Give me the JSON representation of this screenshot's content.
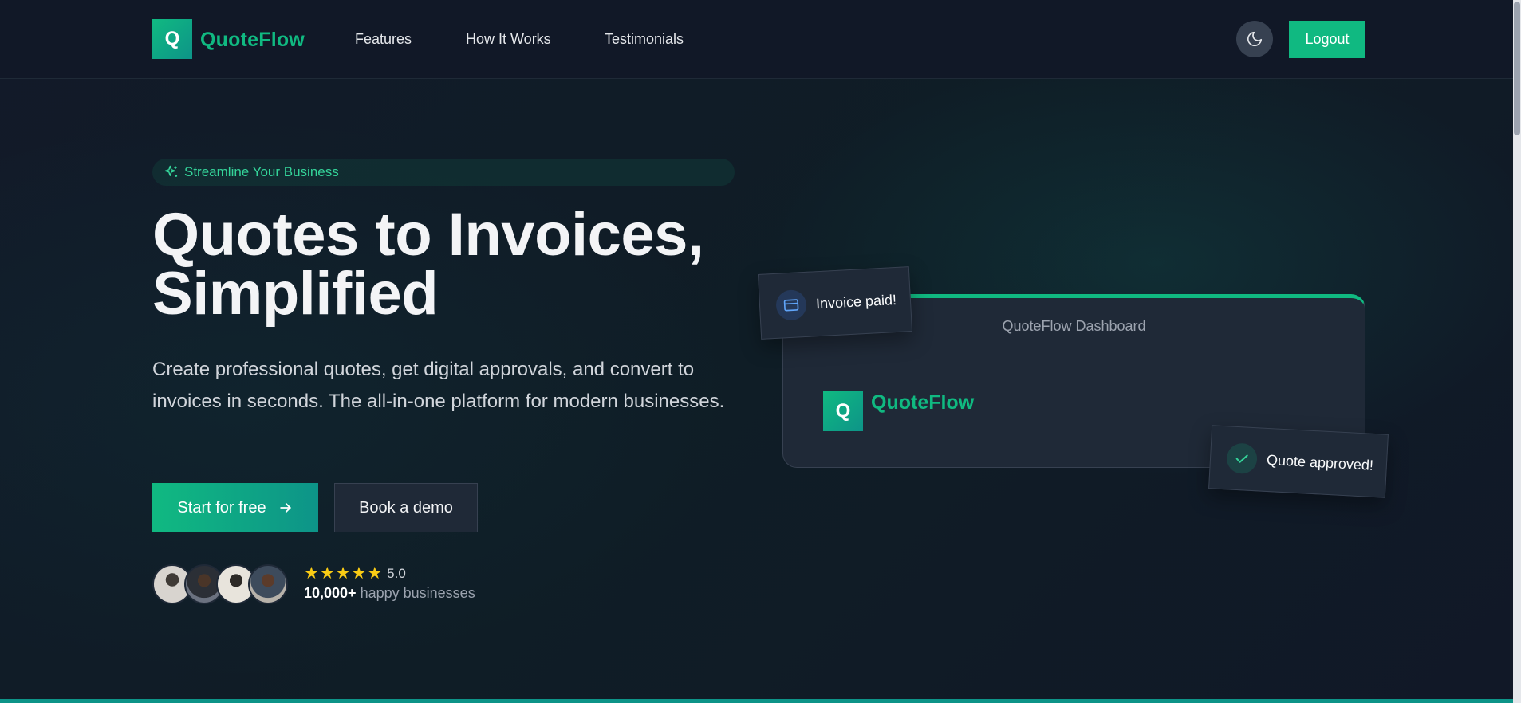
{
  "brand": {
    "logo_letter": "Q",
    "name": "QuoteFlow",
    "accent": "#10b981"
  },
  "nav": {
    "links": [
      "Features",
      "How It Works",
      "Testimonials"
    ],
    "theme_icon": "moon-icon",
    "logout_label": "Logout"
  },
  "hero": {
    "badge_icon": "sparkles-icon",
    "badge": "Streamline Your Business",
    "title_line1": "Quotes to Invoices,",
    "title_line2": "Simplified",
    "subtitle": "Create professional quotes, get digital approvals, and convert to invoices in seconds. The all-in-one platform for modern businesses.",
    "cta_primary": "Start for free",
    "cta_primary_icon": "arrow-right-icon",
    "cta_secondary": "Book a demo"
  },
  "social_proof": {
    "avatars_count": 4,
    "stars": 5,
    "rating": "5.0",
    "count": "10,000+",
    "label": "happy businesses"
  },
  "dashboard": {
    "header": "QuoteFlow Dashboard",
    "logo_letter": "Q",
    "logo_text": "QuoteFlow"
  },
  "toasts": {
    "invoice": {
      "icon": "credit-card-icon",
      "text": "Invoice paid!"
    },
    "quote": {
      "icon": "check-icon",
      "text": "Quote approved!"
    }
  }
}
